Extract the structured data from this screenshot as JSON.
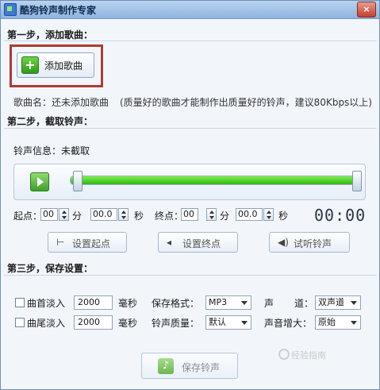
{
  "window": {
    "title": "酷狗铃声制作专家",
    "close_label": "×"
  },
  "step1": {
    "header": "第一步，添加歌曲：",
    "add_button": "添加歌曲",
    "song_name": "歌曲名：还未添加歌曲",
    "hint": "(质量好的歌曲才能制作出质量好的铃声，建议80Kbps以上)"
  },
  "step2": {
    "header": "第二步，截取铃声：",
    "info": "铃声信息：未截取",
    "progress_fraction": 1.0,
    "start_label": "起点：",
    "end_label": "终点：",
    "start_min": "00",
    "start_sec": "00.0",
    "end_min": "00",
    "end_sec": "00.0",
    "unit_min": "分",
    "unit_sec": "秒",
    "time_display": "00:00",
    "set_start": "设置起点",
    "set_end": "设置终点",
    "preview": "试听铃声"
  },
  "step3": {
    "header": "第三步，保存设置：",
    "fade_in": "曲首淡入",
    "fade_out": "曲尾淡入",
    "fade_in_value": "2000",
    "fade_out_value": "2000",
    "ms_unit": "毫秒",
    "format_label": "保存格式：",
    "format_value": "MP3",
    "quality_label": "铃声质量：",
    "quality_value": "默认",
    "channel_label": "声",
    "channel_label2": "道：",
    "channel_value": "双声道",
    "gain_label": "声音增大：",
    "gain_value": "原始",
    "save_button": "保存铃声"
  },
  "watermark": "经验指南",
  "icons": [
    "app-icon",
    "close-icon",
    "plus-icon",
    "play-icon",
    "set-start-icon",
    "set-end-icon",
    "speaker-icon",
    "music-note-icon"
  ],
  "colors": {
    "accent_green": "#32b514",
    "highlight_red": "#b03a30",
    "title_bar": "#8fb4df"
  }
}
